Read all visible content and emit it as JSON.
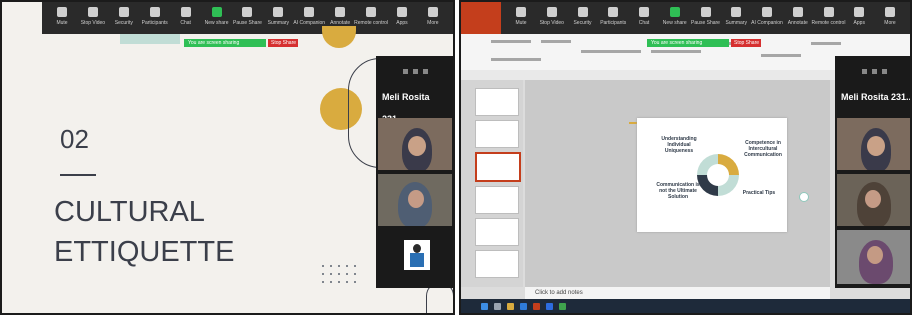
{
  "toolbar": {
    "items": [
      {
        "label": "Mute",
        "icon": "microphone-icon"
      },
      {
        "label": "Stop Video",
        "icon": "camera-icon"
      },
      {
        "label": "Security",
        "icon": "shield-icon"
      },
      {
        "label": "Participants",
        "icon": "people-icon"
      },
      {
        "label": "Chat",
        "icon": "chat-icon"
      },
      {
        "label": "New share",
        "icon": "share-icon"
      },
      {
        "label": "Pause Share",
        "icon": "pause-icon"
      },
      {
        "label": "Summary",
        "icon": "summary-icon"
      },
      {
        "label": "AI Companion",
        "icon": "sparkle-icon"
      },
      {
        "label": "Annotate",
        "icon": "pen-icon"
      },
      {
        "label": "Remote control",
        "icon": "mouse-icon"
      },
      {
        "label": "Apps",
        "icon": "apps-icon"
      },
      {
        "label": "More",
        "icon": "more-icon"
      }
    ],
    "sharing_text": "You are screen sharing",
    "stop_share": "Stop Share"
  },
  "left_slide": {
    "number": "02",
    "title_line1": "CULTURAL",
    "title_line2": "ETTIQUETTE"
  },
  "gallery": {
    "name": "Meli Rosita 231..."
  },
  "right_slide": {
    "q1": "Understanding Individual Uniqueness",
    "q2": "Competence in Intercultural Communication",
    "q3": "Communication is not the Ultimate Solution",
    "q4": "Practical Tips",
    "notes": "Click to add notes"
  },
  "colors": {
    "accent_yellow": "#d9ab3f",
    "teal": "#c1ddd6",
    "navy": "#2f3a48",
    "zoom_green": "#2fbf55",
    "stop_red": "#d63030"
  }
}
